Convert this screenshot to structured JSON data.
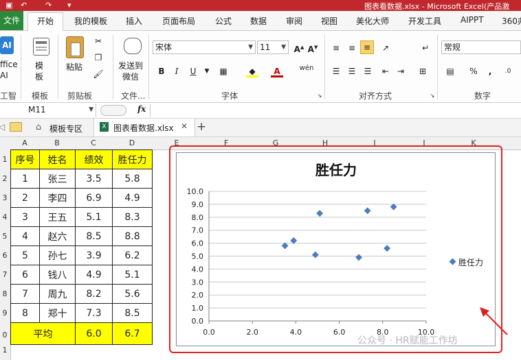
{
  "window": {
    "title": "图表看数据.xlsx - Microsoft Excel(产品激"
  },
  "ribbon_tabs": [
    "文件",
    "开始",
    "我的模板",
    "插入",
    "页面布局",
    "公式",
    "数据",
    "审阅",
    "视图",
    "美化大师",
    "开发工具",
    "AIPPT",
    "360办"
  ],
  "ribbon": {
    "office_ai": [
      "ffice",
      "AI"
    ],
    "office_ai_group": "工智",
    "template_btn": [
      "模",
      "板"
    ],
    "template_group": "模板",
    "paste_btn": "粘贴",
    "clipboard_group": "剪贴板",
    "send_wechat": [
      "发送到",
      "微信"
    ],
    "file_group": "文件...",
    "font_name": "宋体",
    "font_size": "11",
    "font_group": "字体",
    "align_group": "对齐方式",
    "number_format": "常规",
    "number_group": "数字",
    "bold": "B",
    "italic": "I",
    "underline": "U",
    "wen": "wén",
    "pct": "%",
    "comma": ","
  },
  "formula_bar": {
    "name_box": "M11",
    "fx": "fx"
  },
  "doc_tabs": {
    "template_zone": "模板专区",
    "file_tab": "图表看数据.xlsx"
  },
  "columns": [
    "A",
    "B",
    "C",
    "D",
    "E",
    "F",
    "G",
    "H",
    "I",
    "J",
    "K"
  ],
  "rows": [
    "1",
    "2",
    "3",
    "4",
    "5",
    "6",
    "7",
    "8",
    "9",
    "0",
    "1"
  ],
  "table": {
    "headers": [
      "序号",
      "姓名",
      "绩效",
      "胜任力"
    ],
    "rows": [
      [
        "1",
        "张三",
        "3.5",
        "5.8"
      ],
      [
        "2",
        "李四",
        "6.9",
        "4.9"
      ],
      [
        "3",
        "王五",
        "5.1",
        "8.3"
      ],
      [
        "4",
        "赵六",
        "8.5",
        "8.8"
      ],
      [
        "5",
        "孙七",
        "3.9",
        "6.2"
      ],
      [
        "6",
        "钱八",
        "4.9",
        "5.1"
      ],
      [
        "7",
        "周九",
        "8.2",
        "5.6"
      ],
      [
        "8",
        "郑十",
        "7.3",
        "8.5"
      ]
    ],
    "footer": [
      "平均",
      "6.0",
      "6.7"
    ]
  },
  "watermark": "公众号 · HR赋能工作坊",
  "colors": {
    "titlebar": "#c0282d",
    "file_tab": "#2a8a3a",
    "highlight": "#ffff00",
    "marker": "#4a7ebb",
    "annotation": "#e02020"
  },
  "chart_data": {
    "type": "scatter",
    "title": "胜任力",
    "series": [
      {
        "name": "胜任力",
        "x": [
          3.5,
          6.9,
          5.1,
          8.5,
          3.9,
          4.9,
          8.2,
          7.3
        ],
        "y": [
          5.8,
          4.9,
          8.3,
          8.8,
          6.2,
          5.1,
          5.6,
          8.5
        ]
      }
    ],
    "xlim": [
      0,
      10
    ],
    "ylim": [
      0,
      10
    ],
    "xticks": [
      "0.0",
      "2.0",
      "4.0",
      "6.0",
      "8.0",
      "10.0"
    ],
    "yticks": [
      "0.0",
      "1.0",
      "2.0",
      "3.0",
      "4.0",
      "5.0",
      "6.0",
      "7.0",
      "8.0",
      "9.0",
      "10.0"
    ],
    "grid": true,
    "legend": "right"
  }
}
